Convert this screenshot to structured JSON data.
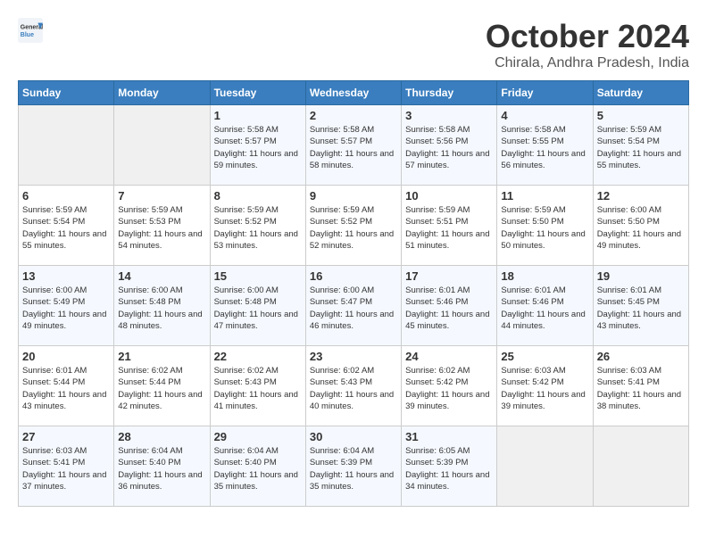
{
  "header": {
    "logo_general": "General",
    "logo_blue": "Blue",
    "month": "October 2024",
    "location": "Chirala, Andhra Pradesh, India"
  },
  "days_of_week": [
    "Sunday",
    "Monday",
    "Tuesday",
    "Wednesday",
    "Thursday",
    "Friday",
    "Saturday"
  ],
  "weeks": [
    [
      {
        "day": "",
        "info": ""
      },
      {
        "day": "",
        "info": ""
      },
      {
        "day": "1",
        "info": "Sunrise: 5:58 AM\nSunset: 5:57 PM\nDaylight: 11 hours and 59 minutes."
      },
      {
        "day": "2",
        "info": "Sunrise: 5:58 AM\nSunset: 5:57 PM\nDaylight: 11 hours and 58 minutes."
      },
      {
        "day": "3",
        "info": "Sunrise: 5:58 AM\nSunset: 5:56 PM\nDaylight: 11 hours and 57 minutes."
      },
      {
        "day": "4",
        "info": "Sunrise: 5:58 AM\nSunset: 5:55 PM\nDaylight: 11 hours and 56 minutes."
      },
      {
        "day": "5",
        "info": "Sunrise: 5:59 AM\nSunset: 5:54 PM\nDaylight: 11 hours and 55 minutes."
      }
    ],
    [
      {
        "day": "6",
        "info": "Sunrise: 5:59 AM\nSunset: 5:54 PM\nDaylight: 11 hours and 55 minutes."
      },
      {
        "day": "7",
        "info": "Sunrise: 5:59 AM\nSunset: 5:53 PM\nDaylight: 11 hours and 54 minutes."
      },
      {
        "day": "8",
        "info": "Sunrise: 5:59 AM\nSunset: 5:52 PM\nDaylight: 11 hours and 53 minutes."
      },
      {
        "day": "9",
        "info": "Sunrise: 5:59 AM\nSunset: 5:52 PM\nDaylight: 11 hours and 52 minutes."
      },
      {
        "day": "10",
        "info": "Sunrise: 5:59 AM\nSunset: 5:51 PM\nDaylight: 11 hours and 51 minutes."
      },
      {
        "day": "11",
        "info": "Sunrise: 5:59 AM\nSunset: 5:50 PM\nDaylight: 11 hours and 50 minutes."
      },
      {
        "day": "12",
        "info": "Sunrise: 6:00 AM\nSunset: 5:50 PM\nDaylight: 11 hours and 49 minutes."
      }
    ],
    [
      {
        "day": "13",
        "info": "Sunrise: 6:00 AM\nSunset: 5:49 PM\nDaylight: 11 hours and 49 minutes."
      },
      {
        "day": "14",
        "info": "Sunrise: 6:00 AM\nSunset: 5:48 PM\nDaylight: 11 hours and 48 minutes."
      },
      {
        "day": "15",
        "info": "Sunrise: 6:00 AM\nSunset: 5:48 PM\nDaylight: 11 hours and 47 minutes."
      },
      {
        "day": "16",
        "info": "Sunrise: 6:00 AM\nSunset: 5:47 PM\nDaylight: 11 hours and 46 minutes."
      },
      {
        "day": "17",
        "info": "Sunrise: 6:01 AM\nSunset: 5:46 PM\nDaylight: 11 hours and 45 minutes."
      },
      {
        "day": "18",
        "info": "Sunrise: 6:01 AM\nSunset: 5:46 PM\nDaylight: 11 hours and 44 minutes."
      },
      {
        "day": "19",
        "info": "Sunrise: 6:01 AM\nSunset: 5:45 PM\nDaylight: 11 hours and 43 minutes."
      }
    ],
    [
      {
        "day": "20",
        "info": "Sunrise: 6:01 AM\nSunset: 5:44 PM\nDaylight: 11 hours and 43 minutes."
      },
      {
        "day": "21",
        "info": "Sunrise: 6:02 AM\nSunset: 5:44 PM\nDaylight: 11 hours and 42 minutes."
      },
      {
        "day": "22",
        "info": "Sunrise: 6:02 AM\nSunset: 5:43 PM\nDaylight: 11 hours and 41 minutes."
      },
      {
        "day": "23",
        "info": "Sunrise: 6:02 AM\nSunset: 5:43 PM\nDaylight: 11 hours and 40 minutes."
      },
      {
        "day": "24",
        "info": "Sunrise: 6:02 AM\nSunset: 5:42 PM\nDaylight: 11 hours and 39 minutes."
      },
      {
        "day": "25",
        "info": "Sunrise: 6:03 AM\nSunset: 5:42 PM\nDaylight: 11 hours and 39 minutes."
      },
      {
        "day": "26",
        "info": "Sunrise: 6:03 AM\nSunset: 5:41 PM\nDaylight: 11 hours and 38 minutes."
      }
    ],
    [
      {
        "day": "27",
        "info": "Sunrise: 6:03 AM\nSunset: 5:41 PM\nDaylight: 11 hours and 37 minutes."
      },
      {
        "day": "28",
        "info": "Sunrise: 6:04 AM\nSunset: 5:40 PM\nDaylight: 11 hours and 36 minutes."
      },
      {
        "day": "29",
        "info": "Sunrise: 6:04 AM\nSunset: 5:40 PM\nDaylight: 11 hours and 35 minutes."
      },
      {
        "day": "30",
        "info": "Sunrise: 6:04 AM\nSunset: 5:39 PM\nDaylight: 11 hours and 35 minutes."
      },
      {
        "day": "31",
        "info": "Sunrise: 6:05 AM\nSunset: 5:39 PM\nDaylight: 11 hours and 34 minutes."
      },
      {
        "day": "",
        "info": ""
      },
      {
        "day": "",
        "info": ""
      }
    ]
  ]
}
